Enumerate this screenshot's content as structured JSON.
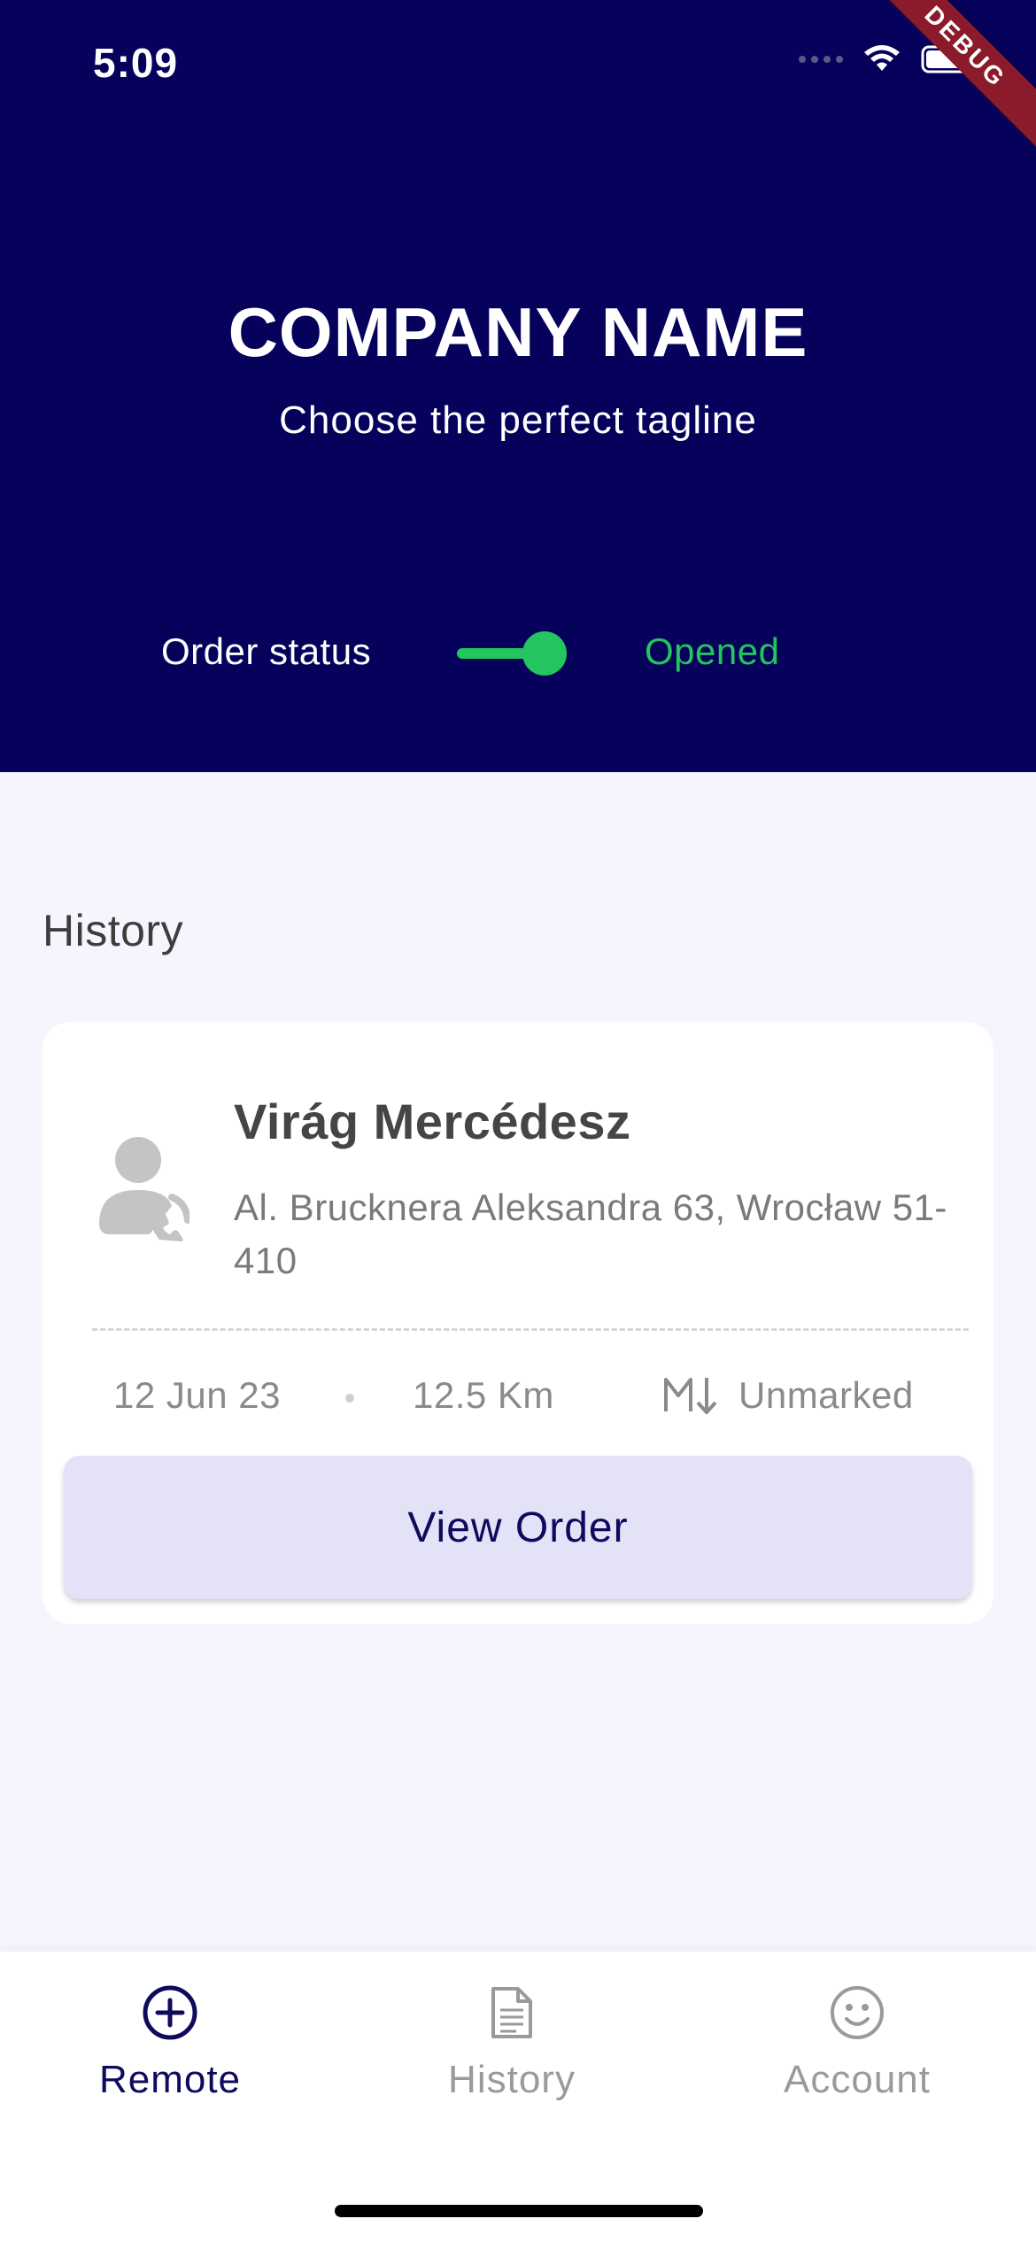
{
  "status_bar": {
    "time": "5:09",
    "debug_label": "DEBUG"
  },
  "header": {
    "company_name": "COMPANY NAME",
    "tagline": "Choose the perfect tagline",
    "order_status_label": "Order status",
    "order_status_value": "Opened",
    "toggle_on": true
  },
  "history": {
    "title": "History",
    "orders": [
      {
        "customer_name": "Virág Mercédesz",
        "address": "Al. Brucknera Aleksandra 63, Wrocław 51-410",
        "date": "12 Jun 23",
        "distance": "12.5 Km",
        "mark_status": "Unmarked",
        "button_label": "View Order"
      }
    ]
  },
  "bottom_nav": {
    "items": [
      {
        "label": "Remote",
        "icon": "plus-circle-icon",
        "active": true
      },
      {
        "label": "History",
        "icon": "document-icon",
        "active": false
      },
      {
        "label": "Account",
        "icon": "smiley-icon",
        "active": false
      }
    ]
  },
  "colors": {
    "header_bg": "#06025c",
    "accent_green": "#22c55e",
    "page_bg": "#f6f5fd",
    "button_bg": "#e4e2f7",
    "nav_active": "#0e0a5e",
    "nav_inactive": "#9a9a9a"
  }
}
